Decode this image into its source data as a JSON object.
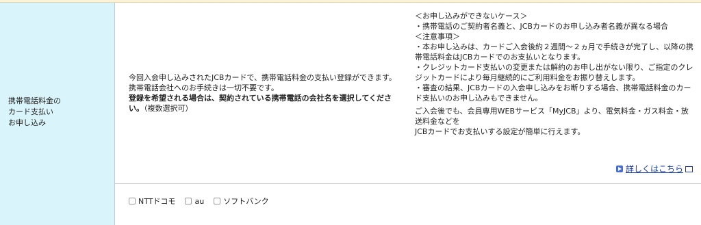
{
  "label": {
    "text": "携帯電話料金の\nカード支払い\nお申し込み"
  },
  "intro": {
    "normal1": "今回入会申し込みされたJCBカードで、携帯電話料金の支払い登録ができます。携帯電話会社へのお手続きは一切不要です。",
    "bold": "登録を希望される場合は、契約されている携帯電話の会社名を選択してください。",
    "normal2": "（複数選択可）"
  },
  "notes": {
    "lines": [
      "＜お申し込みができないケース＞",
      "・携帯電話のご契約者名義と、JCBカードのお申し込み者名義が異なる場合",
      "＜注意事項＞",
      "・本お申し込みは、カードご入会後約２週間〜２ヵ月で手続きが完了し、以降の携帯電話料金はJCBカードでのお支払いとなります。",
      "・クレジットカード支払いの変更または解約のお申し出がない限り、ご指定のクレジットカードにより毎月継続的にご利用料金をお振り替えします。",
      "・審査の結果、JCBカードの入会申し込みをお断りする場合、携帯電話料金のカード支払いのお申し込みもできません。"
    ],
    "extra1": "ご入会後でも、会員専用WEBサービス「MyJCB」より、電気料金・ガス料金・放送料金などを",
    "extra2": "JCBカードでお支払いする設定が簡単に行えます。"
  },
  "link": {
    "text": "詳しくはこちら"
  },
  "carriers": [
    {
      "label": "NTTドコモ"
    },
    {
      "label": "au"
    },
    {
      "label": "ソフトバンク"
    }
  ]
}
